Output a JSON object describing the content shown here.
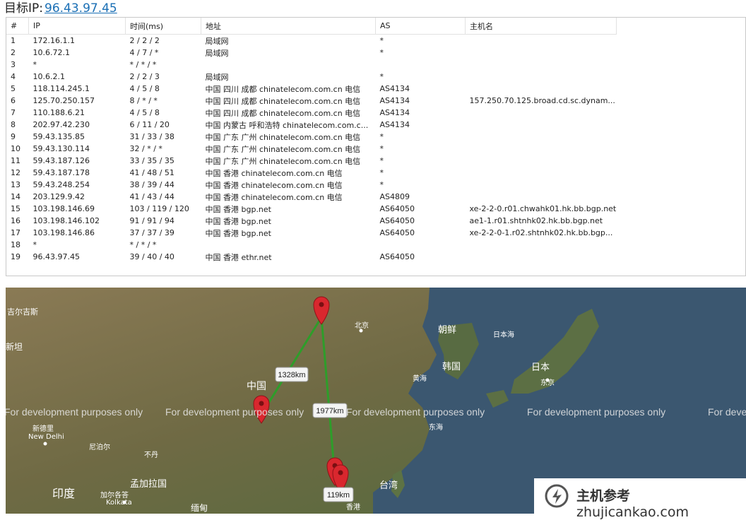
{
  "header": {
    "label": "目标IP:",
    "ip": "96.43.97.45"
  },
  "table": {
    "columns": [
      "#",
      "IP",
      "时间(ms)",
      "地址",
      "AS",
      "主机名"
    ],
    "rows": [
      {
        "n": "1",
        "ip": "172.16.1.1",
        "time": "2 / 2 / 2",
        "addr": "局域网",
        "as": "*",
        "host": ""
      },
      {
        "n": "2",
        "ip": "10.6.72.1",
        "time": "4 / 7 / *",
        "addr": "局域网",
        "as": "*",
        "host": ""
      },
      {
        "n": "3",
        "ip": "*",
        "time": "* / * / *",
        "addr": "",
        "as": "",
        "host": ""
      },
      {
        "n": "4",
        "ip": "10.6.2.1",
        "time": "2 / 2 / 3",
        "addr": "局域网",
        "as": "*",
        "host": ""
      },
      {
        "n": "5",
        "ip": "118.114.245.1",
        "time": "4 / 5 / 8",
        "addr": "中国 四川 成都 chinatelecom.com.cn 电信",
        "as": "AS4134",
        "host": ""
      },
      {
        "n": "6",
        "ip": "125.70.250.157",
        "time": "8 / * / *",
        "addr": "中国 四川 成都 chinatelecom.com.cn 电信",
        "as": "AS4134",
        "host": "157.250.70.125.broad.cd.sc.dynam..."
      },
      {
        "n": "7",
        "ip": "110.188.6.21",
        "time": "4 / 5 / 8",
        "addr": "中国 四川 成都 chinatelecom.com.cn 电信",
        "as": "AS4134",
        "host": ""
      },
      {
        "n": "8",
        "ip": "202.97.42.230",
        "time": "6 / 11 / 20",
        "addr": "中国 内蒙古 呼和浩特 chinatelecom.com.c...",
        "as": "AS4134",
        "host": ""
      },
      {
        "n": "9",
        "ip": "59.43.135.85",
        "time": "31 / 33 / 38",
        "addr": "中国 广东 广州 chinatelecom.com.cn 电信",
        "as": "*",
        "host": ""
      },
      {
        "n": "10",
        "ip": "59.43.130.114",
        "time": "32 / * / *",
        "addr": "中国 广东 广州 chinatelecom.com.cn 电信",
        "as": "*",
        "host": ""
      },
      {
        "n": "11",
        "ip": "59.43.187.126",
        "time": "33 / 35 / 35",
        "addr": "中国 广东 广州 chinatelecom.com.cn 电信",
        "as": "*",
        "host": ""
      },
      {
        "n": "12",
        "ip": "59.43.187.178",
        "time": "41 / 48 / 51",
        "addr": "中国 香港 chinatelecom.com.cn 电信",
        "as": "*",
        "host": ""
      },
      {
        "n": "13",
        "ip": "59.43.248.254",
        "time": "38 / 39 / 44",
        "addr": "中国 香港 chinatelecom.com.cn 电信",
        "as": "*",
        "host": ""
      },
      {
        "n": "14",
        "ip": "203.129.9.42",
        "time": "41 / 43 / 44",
        "addr": "中国 香港 chinatelecom.com.cn 电信",
        "as": "AS4809",
        "host": ""
      },
      {
        "n": "15",
        "ip": "103.198.146.69",
        "time": "103 / 119 / 120",
        "addr": "中国 香港 bgp.net",
        "as": "AS64050",
        "host": "xe-2-2-0.r01.chwahk01.hk.bb.bgp.net"
      },
      {
        "n": "16",
        "ip": "103.198.146.102",
        "time": "91 / 91 / 94",
        "addr": "中国 香港 bgp.net",
        "as": "AS64050",
        "host": "ae1-1.r01.shtnhk02.hk.bb.bgp.net"
      },
      {
        "n": "17",
        "ip": "103.198.146.86",
        "time": "37 / 37 / 39",
        "addr": "中国 香港 bgp.net",
        "as": "AS64050",
        "host": "xe-2-2-0-1.r02.shtnhk02.hk.bb.bgp..."
      },
      {
        "n": "18",
        "ip": "*",
        "time": "* / * / *",
        "addr": "",
        "as": "",
        "host": ""
      },
      {
        "n": "19",
        "ip": "96.43.97.45",
        "time": "39 / 40 / 40",
        "addr": "中国 香港 ethr.net",
        "as": "AS64050",
        "host": ""
      }
    ]
  },
  "map": {
    "place_labels": [
      "吉尔吉斯",
      "新坦",
      "北京",
      "朝鲜",
      "日本海",
      "韩国",
      "日本",
      "东京",
      "中国",
      "黄海",
      "东海",
      "新德里",
      "New Delhi",
      "尼泊尔",
      "不丹",
      "孟加拉国",
      "印度",
      "加尔各答",
      "Kolkata",
      "台湾",
      "缅甸",
      "香港"
    ],
    "distances": [
      "1328km",
      "1977km",
      "119km"
    ],
    "dev_notice": "For development purposes only",
    "markers": [
      "成都",
      "呼和浩特",
      "广州",
      "香港"
    ],
    "colors": {
      "route": "#2e9d2a",
      "marker": "#d9272e",
      "land": "#7a6a45",
      "sea": "#3b5770"
    }
  },
  "watermark": {
    "brand": "主机参考",
    "domain": "zhujicankao.com",
    "sub": "ZHUJICANKAO.COM"
  }
}
